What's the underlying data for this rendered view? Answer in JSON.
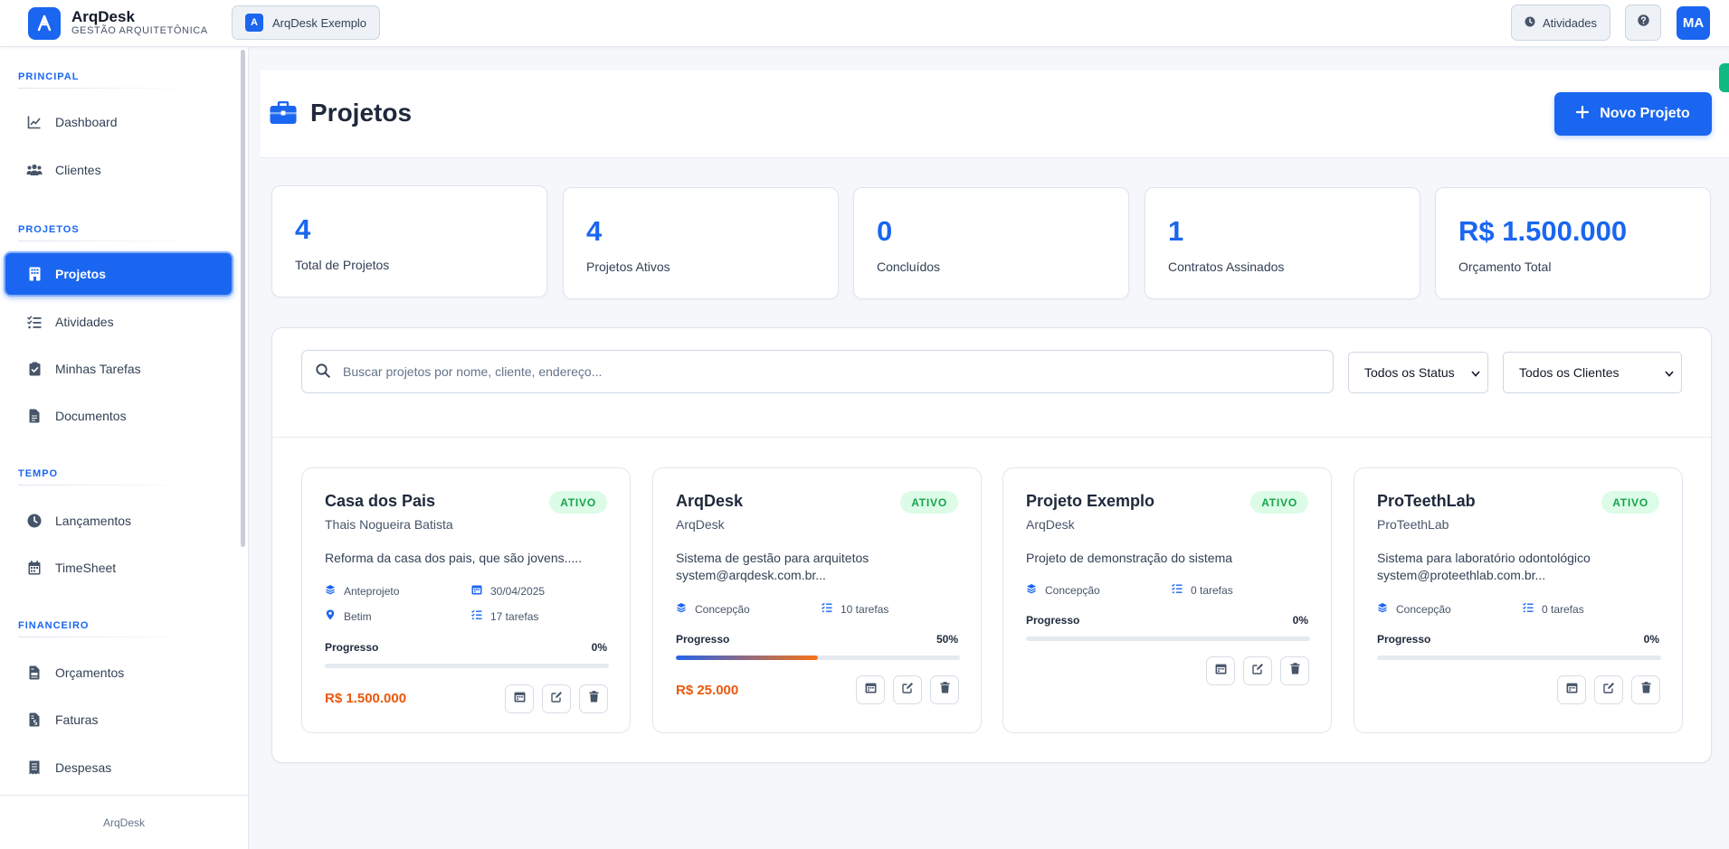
{
  "topbar": {
    "brand_name": "ArqDesk",
    "brand_subtitle": "GESTÃO ARQUITETÔNICA",
    "workspace_initial": "A",
    "workspace_name": "ArqDesk Exemplo",
    "activities_label": "Atividades",
    "avatar_initials": "MA"
  },
  "sidebar": {
    "sections": [
      {
        "label": "PRINCIPAL",
        "items": [
          {
            "label": "Dashboard",
            "icon": "chart-line-icon"
          },
          {
            "label": "Clientes",
            "icon": "users-icon"
          }
        ]
      },
      {
        "label": "PROJETOS",
        "items": [
          {
            "label": "Projetos",
            "icon": "building-icon",
            "active": true
          },
          {
            "label": "Atividades",
            "icon": "list-check-icon"
          },
          {
            "label": "Minhas Tarefas",
            "icon": "clipboard-check-icon"
          },
          {
            "label": "Documentos",
            "icon": "file-icon"
          }
        ]
      },
      {
        "label": "TEMPO",
        "items": [
          {
            "label": "Lançamentos",
            "icon": "clock-icon"
          },
          {
            "label": "TimeSheet",
            "icon": "calendar-icon"
          }
        ]
      },
      {
        "label": "FINANCEIRO",
        "items": [
          {
            "label": "Orçamentos",
            "icon": "file-invoice-icon"
          },
          {
            "label": "Faturas",
            "icon": "file-invoice-dollar-icon"
          },
          {
            "label": "Despesas",
            "icon": "receipt-icon"
          }
        ]
      }
    ],
    "footer": "ArqDesk"
  },
  "page": {
    "title": "Projetos",
    "new_button_label": "Novo Projeto"
  },
  "stats": [
    {
      "value": "4",
      "label": "Total de Projetos"
    },
    {
      "value": "4",
      "label": "Projetos Ativos"
    },
    {
      "value": "0",
      "label": "Concluídos"
    },
    {
      "value": "1",
      "label": "Contratos Assinados"
    },
    {
      "value": "R$ 1.500.000",
      "label": "Orçamento Total"
    }
  ],
  "filters": {
    "search_placeholder": "Buscar projetos por nome, cliente, endereço...",
    "status_selected": "Todos os Status",
    "client_selected": "Todos os Clientes"
  },
  "projects": [
    {
      "name": "Casa dos Pais",
      "status": "ATIVO",
      "client": "Thais Nogueira Batista",
      "description": "Reforma da casa dos pais, que são jovens.....",
      "phase": "Anteprojeto",
      "date": "30/04/2025",
      "location": "Betim",
      "tasks": "17 tarefas",
      "progress_label": "Progresso",
      "progress_text": "0%",
      "progress": 0,
      "budget": "R$ 1.500.000"
    },
    {
      "name": "ArqDesk",
      "status": "ATIVO",
      "client": "ArqDesk",
      "description": "Sistema de gestão para arquitetos system@arqdesk.com.br...",
      "phase": "Concepção",
      "tasks": "10 tarefas",
      "progress_label": "Progresso",
      "progress_text": "50%",
      "progress": 50,
      "budget": "R$ 25.000"
    },
    {
      "name": "Projeto Exemplo",
      "status": "ATIVO",
      "client": "ArqDesk",
      "description": "Projeto de demonstração do sistema",
      "phase": "Concepção",
      "tasks": "0 tarefas",
      "progress_label": "Progresso",
      "progress_text": "0%",
      "progress": 0
    },
    {
      "name": "ProTeethLab",
      "status": "ATIVO",
      "client": "ProTeethLab",
      "description": "Sistema para laboratório odontológico system@proteethlab.com.br...",
      "phase": "Concepção",
      "tasks": "0 tarefas",
      "progress_label": "Progresso",
      "progress_text": "0%",
      "progress": 0
    }
  ],
  "colors": {
    "primary": "#1a66f0",
    "status_active": "#16a34a",
    "budget": "#ea580c"
  }
}
